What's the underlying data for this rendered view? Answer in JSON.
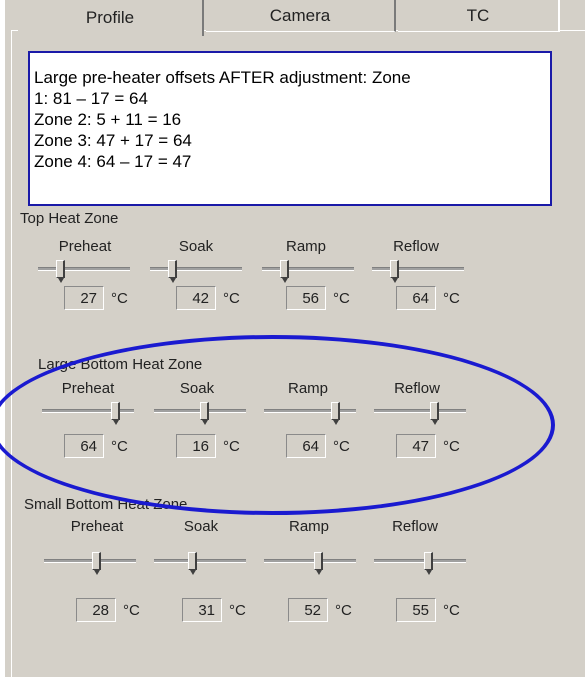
{
  "tabs": [
    {
      "label": "Profile",
      "active": true
    },
    {
      "label": "Camera",
      "active": false
    },
    {
      "label": "TC",
      "active": false
    }
  ],
  "note": {
    "lines": [
      "Large pre-heater offsets AFTER adjustment: Zone",
      "1: 81 – 17 = 64",
      "Zone 2: 5 + 11 = 16",
      "Zone 3: 47 + 17 = 64",
      "Zone 4: 64 – 17 = 47"
    ]
  },
  "unit": "°C",
  "columns": [
    "Preheat",
    "Soak",
    "Ramp",
    "Reflow"
  ],
  "groups": [
    {
      "title": "Top Heat Zone",
      "values": [
        "27",
        "42",
        "56",
        "64"
      ],
      "slider_fraction": [
        0.25,
        0.25,
        0.25,
        0.25
      ]
    },
    {
      "title": "Large Bottom Heat Zone",
      "values": [
        "64",
        "16",
        "64",
        "47"
      ],
      "slider_fraction": [
        0.8,
        0.55,
        0.75,
        0.65
      ]
    },
    {
      "title": "Small Bottom Heat Zone",
      "values": [
        "28",
        "31",
        "52",
        "55"
      ],
      "slider_fraction": [
        0.6,
        0.4,
        0.6,
        0.6
      ]
    }
  ],
  "colors": {
    "panel": "#d4d0c8",
    "annotation": "#1a1aa8"
  }
}
